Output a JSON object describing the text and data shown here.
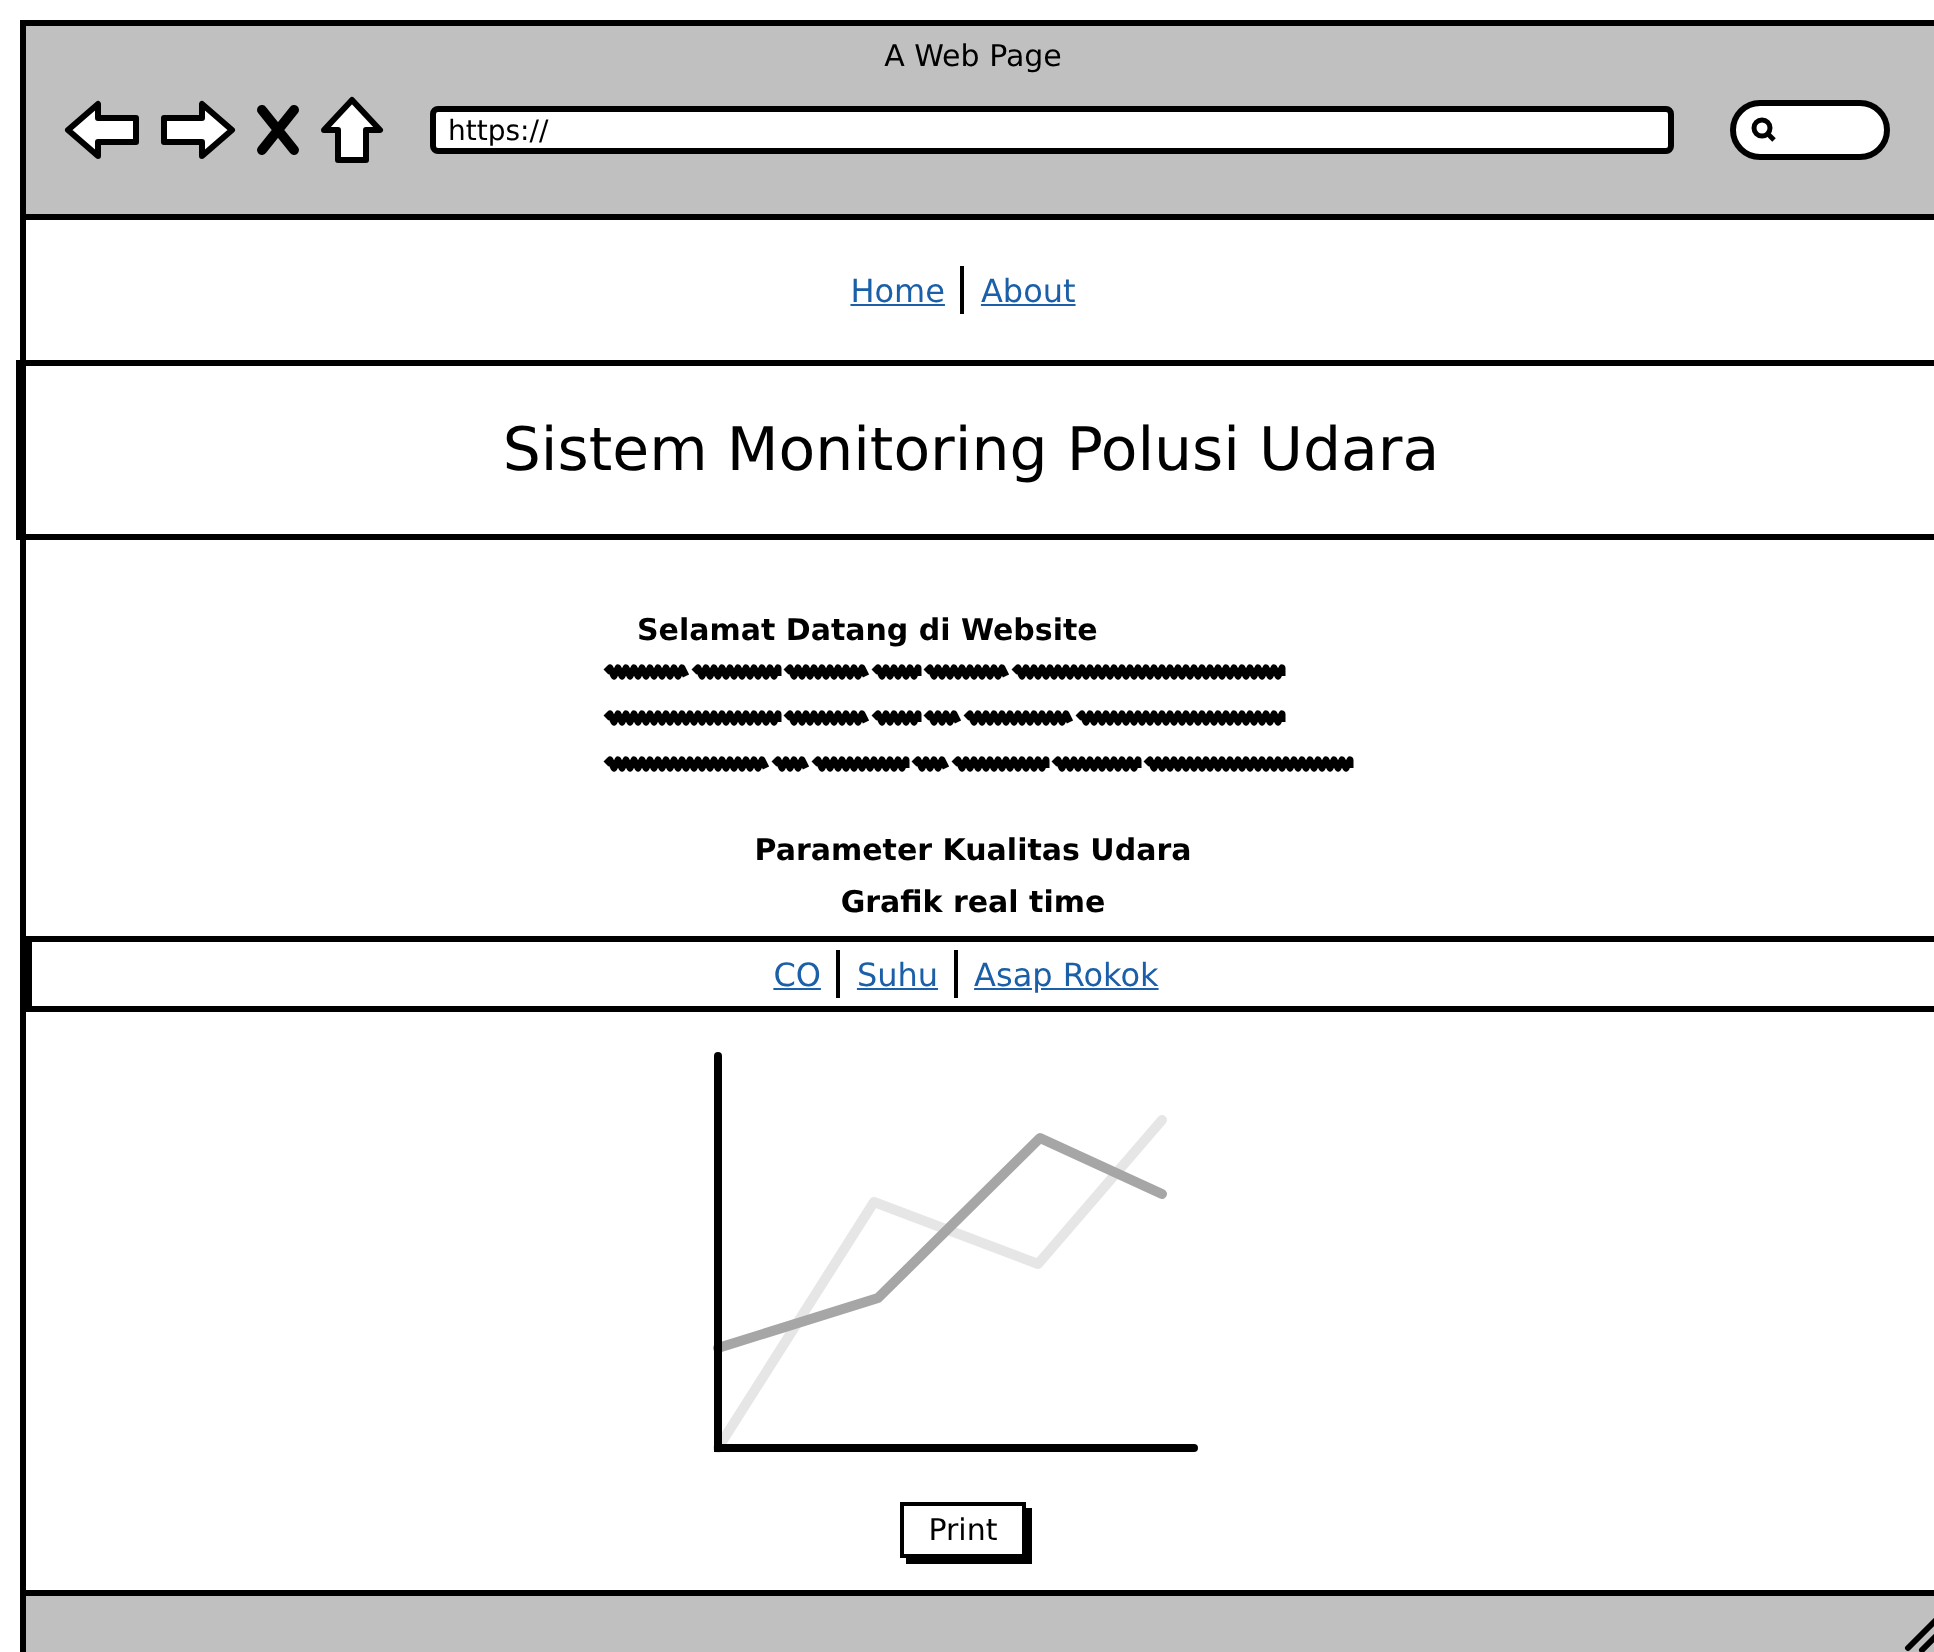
{
  "window": {
    "title": "A Web Page"
  },
  "address_bar": {
    "value": "https://"
  },
  "nav_links": [
    "Home",
    "About"
  ],
  "header": {
    "title": "Sistem Monitoring Polusi Udara"
  },
  "welcome": {
    "heading": "Selamat Datang di Website"
  },
  "section": {
    "title": "Parameter Kualitas Udara",
    "subtitle": "Grafik real time"
  },
  "tabs": [
    "CO",
    "Suhu",
    "Asap Rokok"
  ],
  "print_button": "Print"
}
